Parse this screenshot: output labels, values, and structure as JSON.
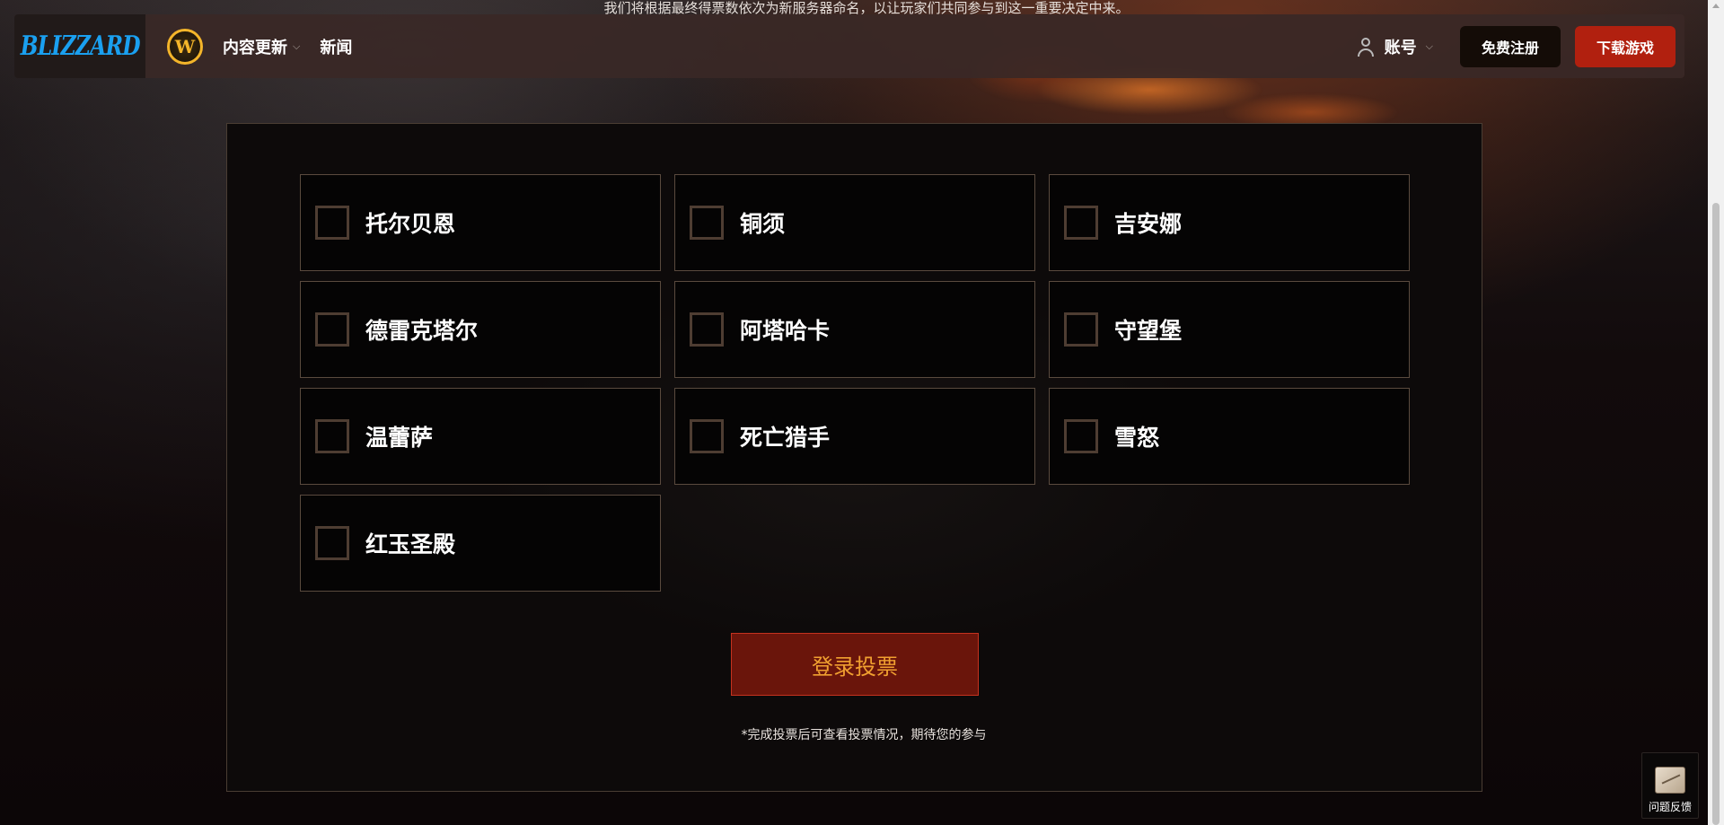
{
  "announcement": "我们将根据最终得票数依次为新服务器命名，以让玩家们共同参与到这一重要决定中来。",
  "nav": {
    "logo_text": "BLIZZARD",
    "game_badge": "W",
    "items": [
      {
        "label": "内容更新",
        "has_dropdown": true
      },
      {
        "label": "新闻",
        "has_dropdown": false
      }
    ],
    "account_label": "账号",
    "free_signup_label": "免费注册",
    "download_label": "下载游戏"
  },
  "vote": {
    "options": [
      "托尔贝恩",
      "铜须",
      "吉安娜",
      "德雷克塔尔",
      "阿塔哈卡",
      "守望堡",
      "温蕾萨",
      "死亡猎手",
      "雪怒",
      "红玉圣殿"
    ],
    "submit_label": "登录投票",
    "note": "*完成投票后可查看投票情况，期待您的参与"
  },
  "feedback": {
    "label": "问题反馈"
  },
  "colors": {
    "accent_red": "#b1200f",
    "vote_button_bg": "#6a150b",
    "vote_button_text": "#f0a030",
    "logo_blue": "#1aa0f0",
    "wow_gold": "#f4b52a"
  }
}
